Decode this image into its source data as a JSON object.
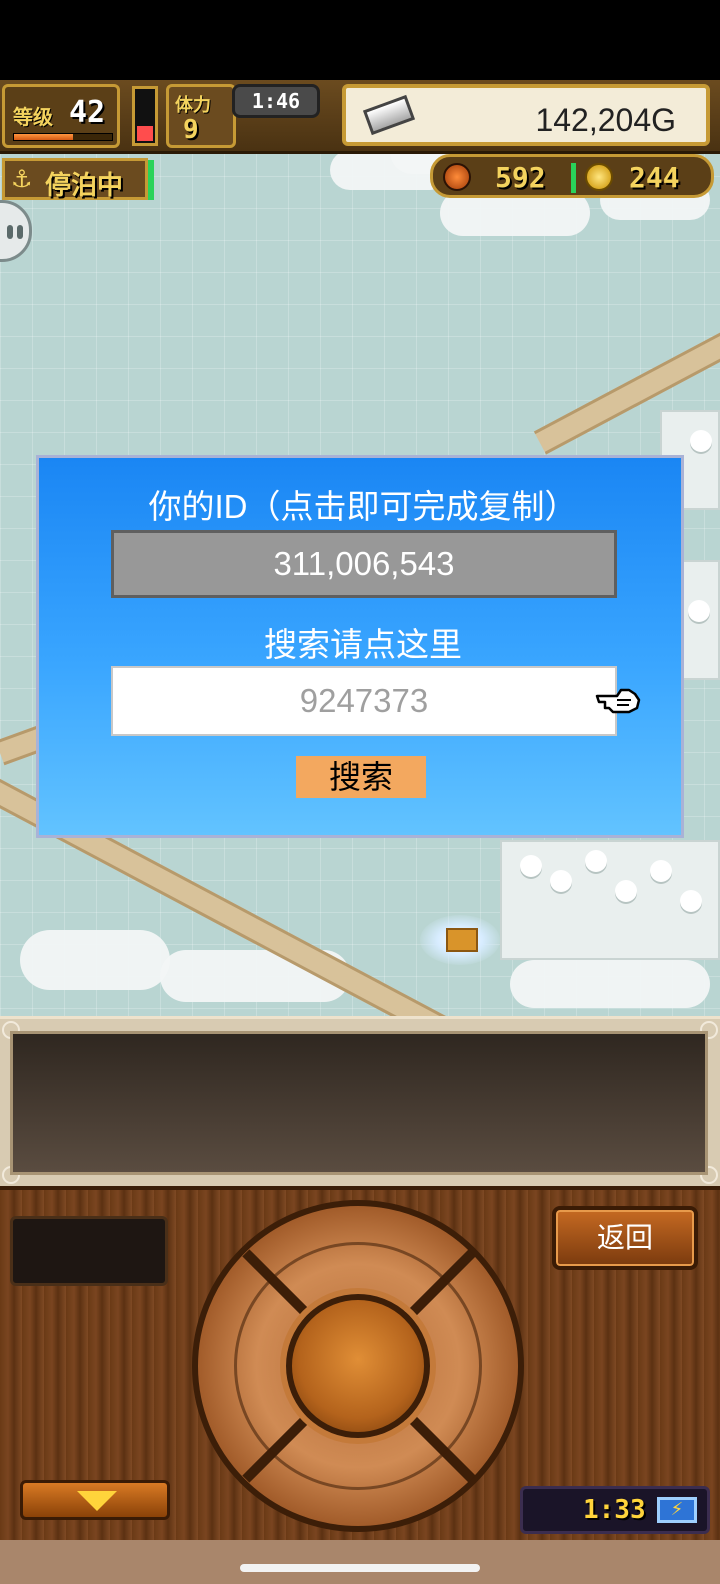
{
  "hud": {
    "level_label": "等级",
    "level_value": "42",
    "level_progress": 0.6,
    "stamina_label": "体力",
    "stamina_value": "9",
    "stamina_gauge_fill": 0.3,
    "stamina_timer": "1:46",
    "gold": "142,204G",
    "status": "停泊中",
    "food": "592",
    "coins": "244"
  },
  "dialog": {
    "title": "你的ID（点击即可完成复制）",
    "player_id": "311,006,543",
    "search_hint": "搜索请点这里",
    "search_value": "9247373",
    "search_button": "搜索"
  },
  "controls": {
    "back_label": "返回",
    "clock": "1:33"
  },
  "colors": {
    "dialog_top": "#1a86f4",
    "dialog_bottom": "#62c3ff",
    "search_button": "#f3a85f",
    "id_box": "#989898",
    "hud_gold_text": "#f4d35e"
  },
  "icons": {
    "anchor": "anchor-icon",
    "silver": "silver-ingot-icon",
    "food": "food-icon",
    "coin": "coin-icon",
    "pointer": "hand-pointer-icon",
    "battery": "battery-charging-icon",
    "down_arrow": "chevron-down-icon"
  }
}
